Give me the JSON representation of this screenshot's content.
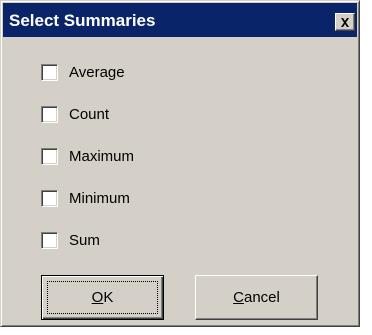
{
  "dialog": {
    "title": "Select Summaries",
    "close_icon": "close-x-icon"
  },
  "options": [
    {
      "label": "Average",
      "checked": false
    },
    {
      "label": "Count",
      "checked": false
    },
    {
      "label": "Maximum",
      "checked": false
    },
    {
      "label": "Minimum",
      "checked": false
    },
    {
      "label": "Sum",
      "checked": false
    }
  ],
  "buttons": {
    "ok_label": "OK",
    "cancel_label": "Cancel"
  },
  "colors": {
    "titlebar": "#0a246a",
    "face": "#d4d0c8"
  }
}
